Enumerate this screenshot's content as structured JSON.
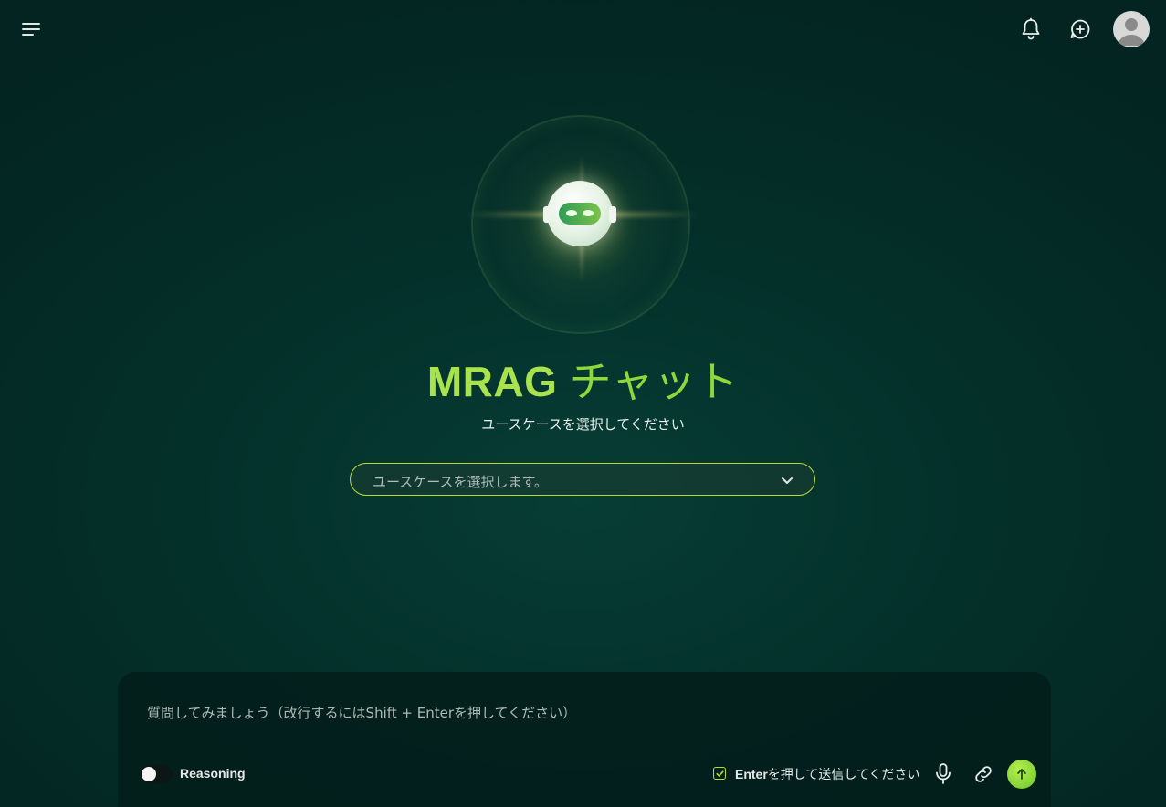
{
  "header": {
    "menu_icon": "hamburger-menu-icon",
    "notifications_icon": "bell-icon",
    "new_chat_icon": "chat-plus-icon",
    "avatar_icon": "user-avatar-icon"
  },
  "hero": {
    "title_latin": "MRAG",
    "title_jp": "チャット",
    "subtitle": "ユースケースを選択してください",
    "bot_icon": "robot-icon"
  },
  "usecase_select": {
    "placeholder": "ユースケースを選択します。"
  },
  "composer": {
    "placeholder": "質問してみましょう（改行するにはShift + Enterを押してください）",
    "reasoning_label": "Reasoning",
    "reasoning_enabled": false,
    "enter_to_send_checked": true,
    "enter_to_send_prefix": "Enter",
    "enter_to_send_rest": "を押して送信してください",
    "mic_icon": "microphone-icon",
    "attach_icon": "link-icon",
    "send_icon": "arrow-up-icon"
  },
  "colors": {
    "accent": "#a8e34d",
    "select_border": "#b7dd2e",
    "send_button": "#8fdb3a",
    "background": "#04302a"
  }
}
